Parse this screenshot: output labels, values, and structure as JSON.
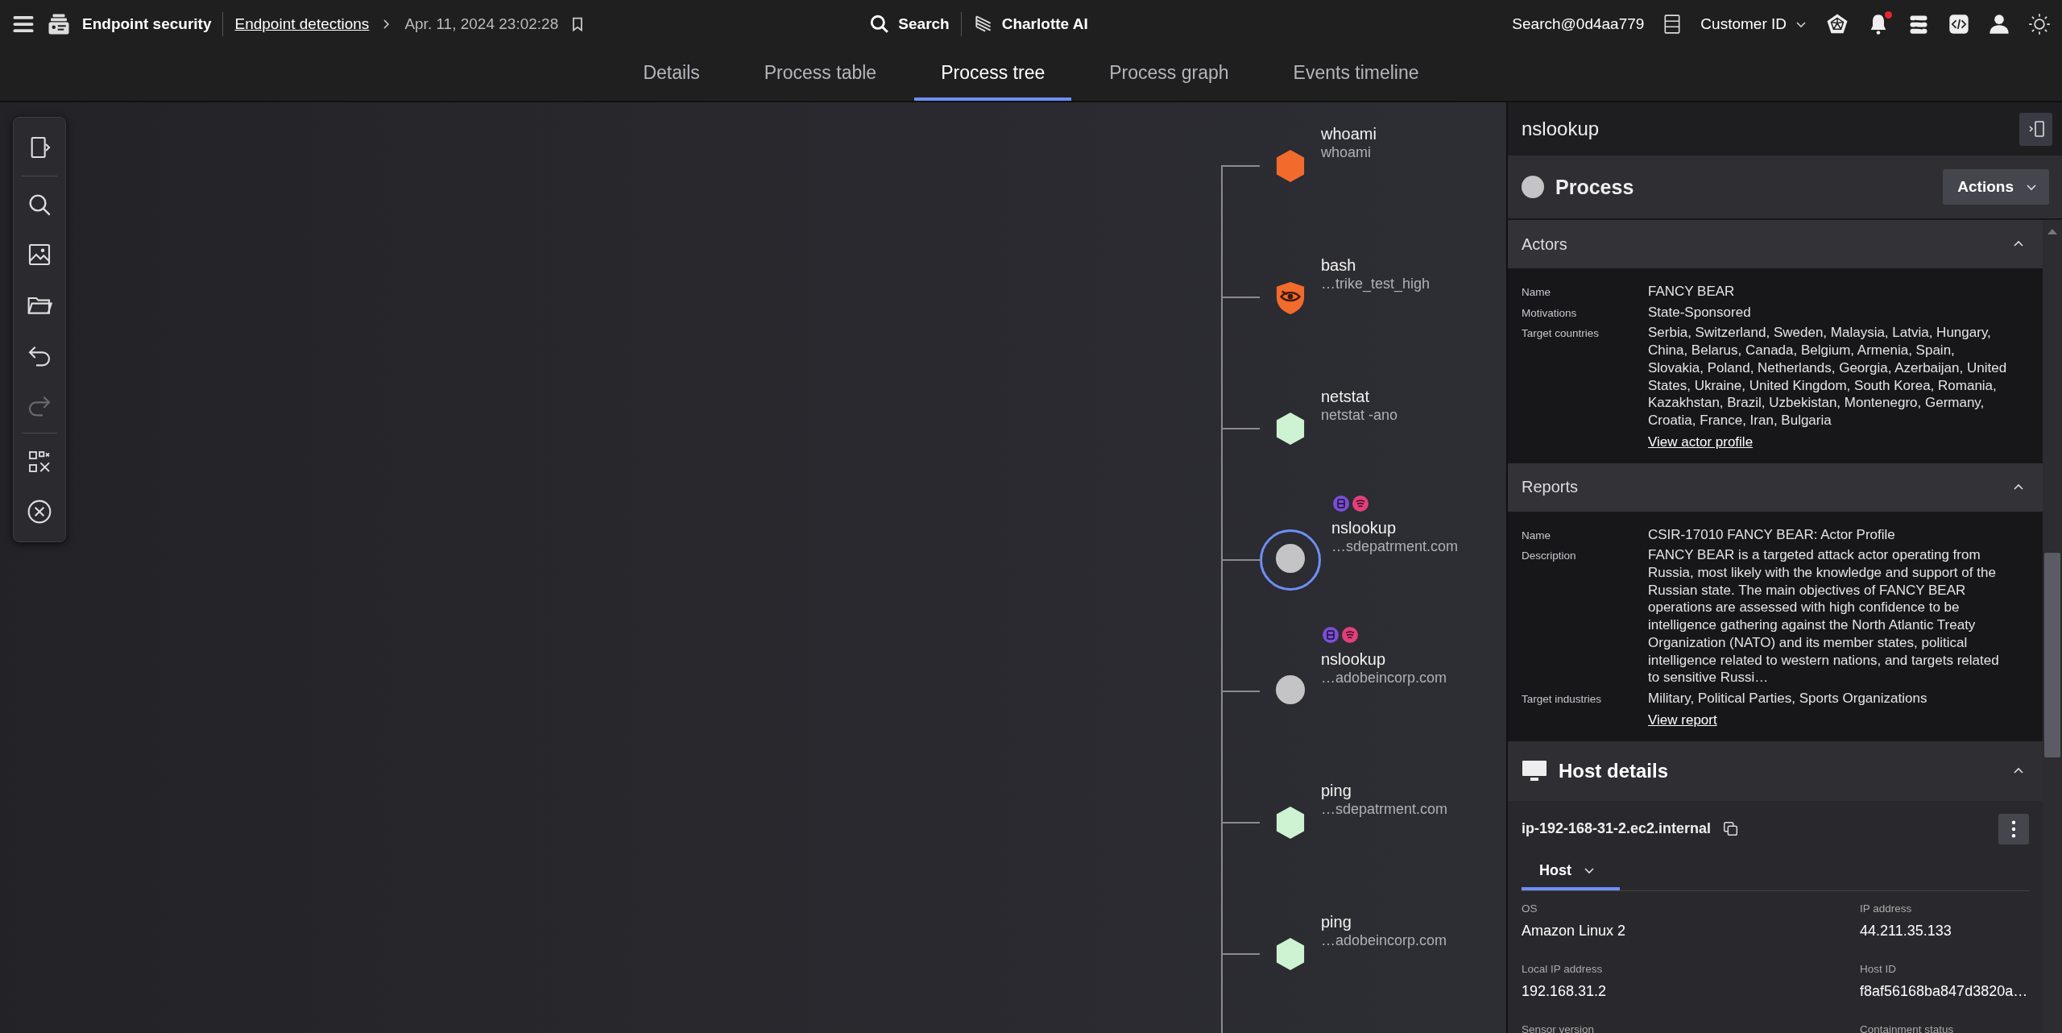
{
  "top_bar": {
    "app_title": "Endpoint security",
    "breadcrumb": [
      {
        "label": "Endpoint detections",
        "kind": "link"
      },
      {
        "label": "Apr. 11, 2024 23:02:28",
        "kind": "text"
      }
    ],
    "search_label": "Search",
    "assistant_label": "Charlotte AI",
    "account": "Search@0d4aa779",
    "customer_menu": "Customer ID",
    "notifications_unread": true
  },
  "tabs": [
    {
      "label": "Details",
      "selected": false
    },
    {
      "label": "Process table",
      "selected": false
    },
    {
      "label": "Process tree",
      "selected": true
    },
    {
      "label": "Process graph",
      "selected": false
    },
    {
      "label": "Events timeline",
      "selected": false
    }
  ],
  "toolbar": {
    "redo_disabled": true
  },
  "process_tree": {
    "nodes": [
      {
        "name": "whoami",
        "detail": "whoami",
        "kind": "hexagon",
        "color": "#f26b2c",
        "selected": false,
        "badges": false
      },
      {
        "name": "bash",
        "detail": "…trike_test_high",
        "kind": "shield",
        "color": "#f26b2c",
        "selected": false,
        "badges": false
      },
      {
        "name": "netstat",
        "detail": "netstat -ano",
        "kind": "hexagon",
        "color": "#cdf3d2",
        "selected": false,
        "badges": false
      },
      {
        "name": "nslookup",
        "detail": "…sdepatrment.com",
        "kind": "circle",
        "color": "#c4c4c6",
        "selected": true,
        "badges": true
      },
      {
        "name": "nslookup",
        "detail": "…adobeincorp.com",
        "kind": "circle",
        "color": "#c4c4c6",
        "selected": false,
        "badges": true
      },
      {
        "name": "ping",
        "detail": "…sdepatrment.com",
        "kind": "hexagon",
        "color": "#cdf3d2",
        "selected": false,
        "badges": false
      },
      {
        "name": "ping",
        "detail": "…adobeincorp.com",
        "kind": "hexagon",
        "color": "#cdf3d2",
        "selected": false,
        "badges": false
      }
    ]
  },
  "details_panel": {
    "title": "nslookup",
    "process_label": "Process",
    "actions_button": "Actions",
    "sections": [
      {
        "title": "Actors",
        "expanded": true,
        "fields": [
          {
            "label": "Name",
            "value": "FANCY BEAR"
          },
          {
            "label": "Motivations",
            "value": "State-Sponsored"
          },
          {
            "label": "Target countries",
            "value": "Serbia, Switzerland, Sweden, Malaysia, Latvia, Hungary, China, Belarus, Canada, Belgium, Armenia, Spain, Slovakia, Poland, Netherlands, Georgia, Azerbaijan, United States, Ukraine, United Kingdom, South Korea, Romania, Kazakhstan, Brazil, Uzbekistan, Montenegro, Germany, Croatia, France, Iran, Bulgaria"
          }
        ],
        "link": "View actor profile"
      },
      {
        "title": "Reports",
        "expanded": true,
        "fields": [
          {
            "label": "Name",
            "value": "CSIR-17010 FANCY BEAR: Actor Profile"
          },
          {
            "label": "Description",
            "value": "FANCY BEAR is a targeted attack actor operating from Russia, most likely with the knowledge and support of the Russian state. The main objectives of FANCY BEAR operations are assessed with high confidence to be intelligence gathering against the North Atlantic Treaty Organization (NATO) and its member states, political intelligence related to western nations, and targets related to sensitive Russi…"
          },
          {
            "label": "Target industries",
            "value": "Military, Political Parties, Sports Organizations"
          }
        ],
        "link": "View report"
      }
    ],
    "host": {
      "title": "Host details",
      "expanded": true,
      "hostname": "ip-192-168-31-2.ec2.internal",
      "tab": "Host",
      "fields": [
        {
          "label": "OS",
          "value": "Amazon Linux 2"
        },
        {
          "label": "IP address",
          "value": "44.211.35.133"
        },
        {
          "label": "Local IP address",
          "value": "192.168.31.2"
        },
        {
          "label": "Host ID",
          "value": "f8af56168ba847d3820a…"
        },
        {
          "label": "Sensor version"
        },
        {
          "label": "Containment status"
        }
      ]
    }
  }
}
